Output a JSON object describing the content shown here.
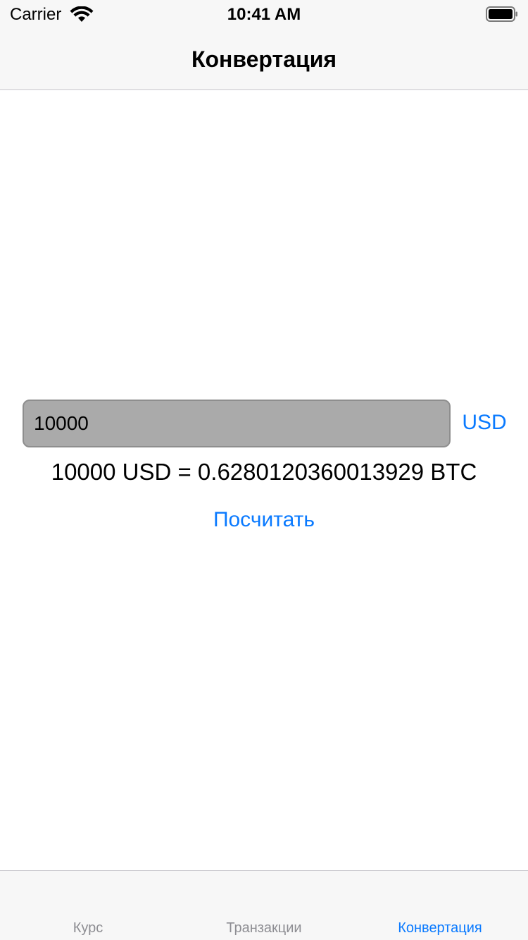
{
  "status_bar": {
    "carrier": "Carrier",
    "time": "10:41 AM"
  },
  "nav": {
    "title": "Конвертация"
  },
  "converter": {
    "amount_value": "10000",
    "currency_label": "USD",
    "result_text": "10000 USD = 0.6280120360013929 BTC",
    "calculate_label": "Посчитать"
  },
  "tabs": [
    {
      "label": "Курс",
      "active": false
    },
    {
      "label": "Транзакции",
      "active": false
    },
    {
      "label": "Конвертация",
      "active": true
    }
  ],
  "colors": {
    "accent": "#0a7aff",
    "inactive_tab": "#8e8e93",
    "field_background": "#aaaaaa"
  }
}
